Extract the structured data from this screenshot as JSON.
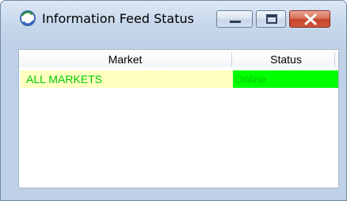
{
  "window": {
    "title": "Information Feed Status",
    "icon": "refresh-globe-icon",
    "controls": {
      "minimize": "minimize-icon",
      "maximize": "maximize-icon",
      "close": "close-icon"
    }
  },
  "table": {
    "columns": [
      "Market",
      "Status"
    ],
    "rows": [
      {
        "market": "ALL MARKETS",
        "status": "Online"
      }
    ]
  },
  "colors": {
    "market_cell_bg": "#ffffc0",
    "status_cell_bg": "#00ff00",
    "row_text": "#00cc00",
    "close_button": "#c5442a"
  }
}
